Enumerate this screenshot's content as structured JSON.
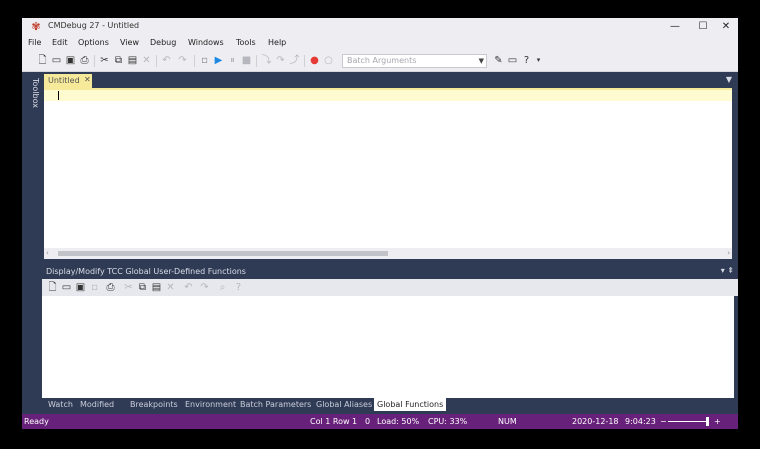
{
  "window": {
    "title": "CMDebug 27 - Untitled",
    "controls": {
      "minimize": "—",
      "maximize": "☐",
      "close": "✕"
    }
  },
  "menu": [
    "File",
    "Edit",
    "Options",
    "View",
    "Debug",
    "Windows",
    "Tools",
    "Help"
  ],
  "toolbar": {
    "args_placeholder": "Batch Arguments",
    "icons": [
      "new-file-icon",
      "open-icon",
      "save-icon",
      "print-icon",
      "cut-icon",
      "copy-icon",
      "paste-icon",
      "delete-icon",
      "undo-icon",
      "redo-icon",
      "run-icon",
      "pause-icon",
      "stop-icon",
      "step-into-icon",
      "step-over-icon",
      "step-out-icon",
      "breakpoint-icon",
      "clear-breakpoint-icon",
      "tools-icon",
      "window-icon",
      "help-icon"
    ]
  },
  "toolbox": {
    "label": "Toolbox"
  },
  "document": {
    "tab_label": "Untitled",
    "tab_close": "✕"
  },
  "panel": {
    "title": "Display/Modify TCC Global User-Defined Functions"
  },
  "bottom_tabs": [
    "Watch",
    "Modified",
    "Breakpoints",
    "Environment",
    "Batch Parameters",
    "Global Aliases"
  ],
  "bottom_tab_active": "Global Functions",
  "status": {
    "ready": "Ready",
    "position": "Col 1  Row 1",
    "zero": "0",
    "load": "Load: 50%",
    "cpu": "CPU: 33%",
    "num": "NUM",
    "date": "2020-12-18",
    "time": "9:04:23",
    "zoom_minus": "−",
    "zoom_plus": "+"
  },
  "colors": {
    "frame": "#2f3b55",
    "chrome": "#eeeef2",
    "status_bar": "#68217a",
    "current_line": "#fffbd0",
    "tab_highlight": "#f6ea9a"
  }
}
